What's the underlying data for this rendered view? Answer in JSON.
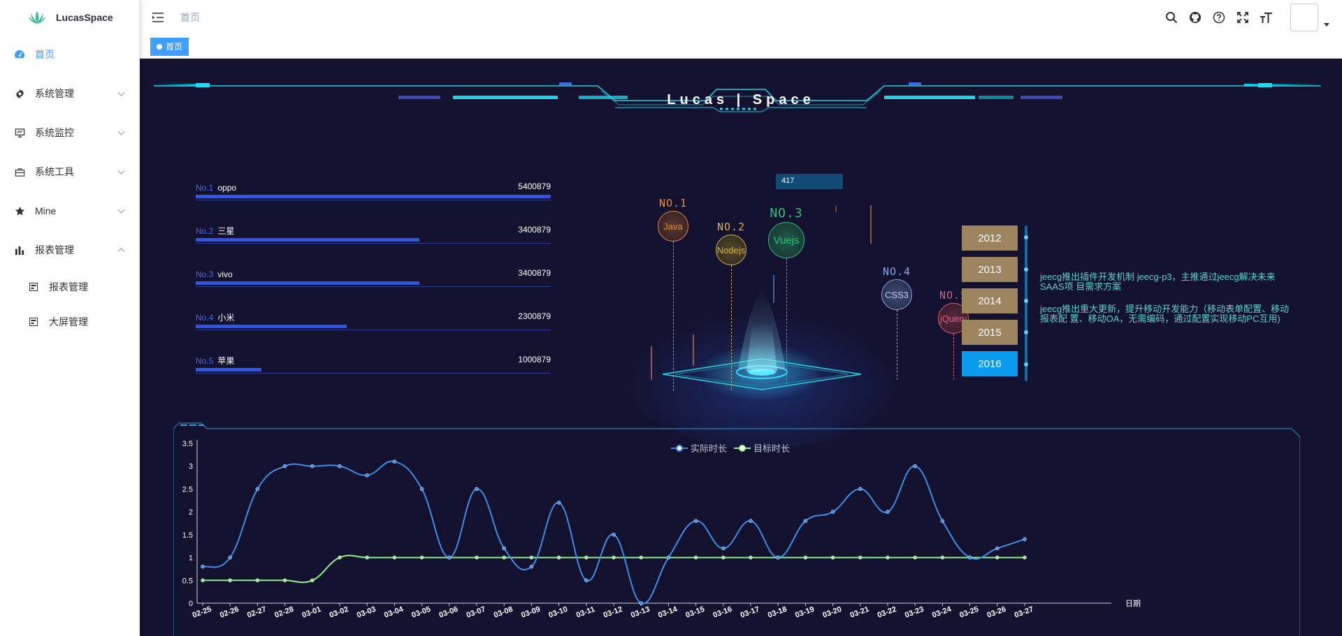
{
  "app": {
    "logo_text": "LucasSpace"
  },
  "sidebar": {
    "items": [
      {
        "label": "首页",
        "icon": "dashboard-icon",
        "active": true
      },
      {
        "label": "系统管理",
        "icon": "gear-icon"
      },
      {
        "label": "系统监控",
        "icon": "monitor-icon"
      },
      {
        "label": "系统工具",
        "icon": "toolbox-icon"
      },
      {
        "label": "Mine",
        "icon": "star-icon"
      },
      {
        "label": "报表管理",
        "icon": "bar-chart-icon",
        "expanded": true
      }
    ],
    "subitems": [
      {
        "label": "报表管理",
        "icon": "report-icon"
      },
      {
        "label": "大屏管理",
        "icon": "screen-icon"
      }
    ]
  },
  "header": {
    "breadcrumb": "首页",
    "icons": [
      "search-icon",
      "github-icon",
      "help-icon",
      "fullscreen-icon",
      "font-size-icon"
    ]
  },
  "tags": {
    "active_tag": "首页"
  },
  "dashboard": {
    "title": "Lucas | Space",
    "ranking": [
      {
        "no": "No.1",
        "name": "oppo",
        "value": "5400879",
        "ratio": 1.0
      },
      {
        "no": "No.2",
        "name": "三星",
        "value": "3400879",
        "ratio": 0.63
      },
      {
        "no": "No.3",
        "name": "vivo",
        "value": "3400879",
        "ratio": 0.63
      },
      {
        "no": "No.4",
        "name": "小米",
        "value": "2300879",
        "ratio": 0.426
      },
      {
        "no": "No.5",
        "name": "苹果",
        "value": "1000879",
        "ratio": 0.185
      }
    ],
    "center_badge": "417",
    "tech": [
      {
        "label": "NO.1",
        "name": "Java",
        "color": "#e48a4a"
      },
      {
        "label": "NO.2",
        "name": "Nodejs",
        "color": "#d4b34a"
      },
      {
        "label": "NO.3",
        "name": "Vuejs",
        "color": "#2fbf7a"
      },
      {
        "label": "NO.4",
        "name": "CSS3",
        "color": "#8aa6e8"
      },
      {
        "label": "NO.5",
        "name": "jQuery",
        "color": "#e0607e"
      }
    ],
    "years": [
      "2012",
      "2013",
      "2014",
      "2015",
      "2016"
    ],
    "active_year": "2016",
    "timeline_texts": [
      "jeecg推出插件开发机制 jeecg-p3，主推通过jeecg解决未来SAAS项 目需求方案",
      "jeecg推出重大更新，提升移动开发能力（移动表单配置、移动报表配 置、移动OA，无需编码，通过配置实现移动PC互用)"
    ]
  },
  "chart_data": {
    "type": "line",
    "x": [
      "02-25",
      "02-26",
      "02-27",
      "02-28",
      "03-01",
      "03-02",
      "03-03",
      "03-04",
      "03-05",
      "03-06",
      "03-07",
      "03-08",
      "03-09",
      "03-10",
      "03-11",
      "03-12",
      "03-13",
      "03-14",
      "03-15",
      "03-16",
      "03-17",
      "03-18",
      "03-19",
      "03-20",
      "03-21",
      "03-22",
      "03-23",
      "03-24",
      "03-25",
      "03-26",
      "03-27"
    ],
    "series": [
      {
        "name": "实际时长",
        "color": "#3b8fe8",
        "values": [
          0.8,
          1,
          2.5,
          3,
          3,
          3,
          2.8,
          3.1,
          2.5,
          1,
          2.5,
          1.2,
          0.8,
          2.2,
          0.5,
          1.5,
          0,
          1,
          1.8,
          1.2,
          1.8,
          1,
          1.8,
          2,
          2.5,
          2,
          3,
          1.8,
          1,
          1.2,
          1.4
        ]
      },
      {
        "name": "目标时长",
        "color": "#90ee90",
        "values": [
          0.5,
          0.5,
          0.5,
          0.5,
          0.5,
          1,
          1,
          1,
          1,
          1,
          1,
          1,
          1,
          1,
          1,
          1,
          1,
          1,
          1,
          1,
          1,
          1,
          1,
          1,
          1,
          1,
          1,
          1,
          1,
          1,
          1
        ]
      }
    ],
    "xlabel": "日期",
    "ylim": [
      0,
      3.5
    ],
    "yticks": [
      "0",
      "0.5",
      "1",
      "1.5",
      "2",
      "2.5",
      "3",
      "3.5"
    ],
    "legend": "top-center"
  }
}
